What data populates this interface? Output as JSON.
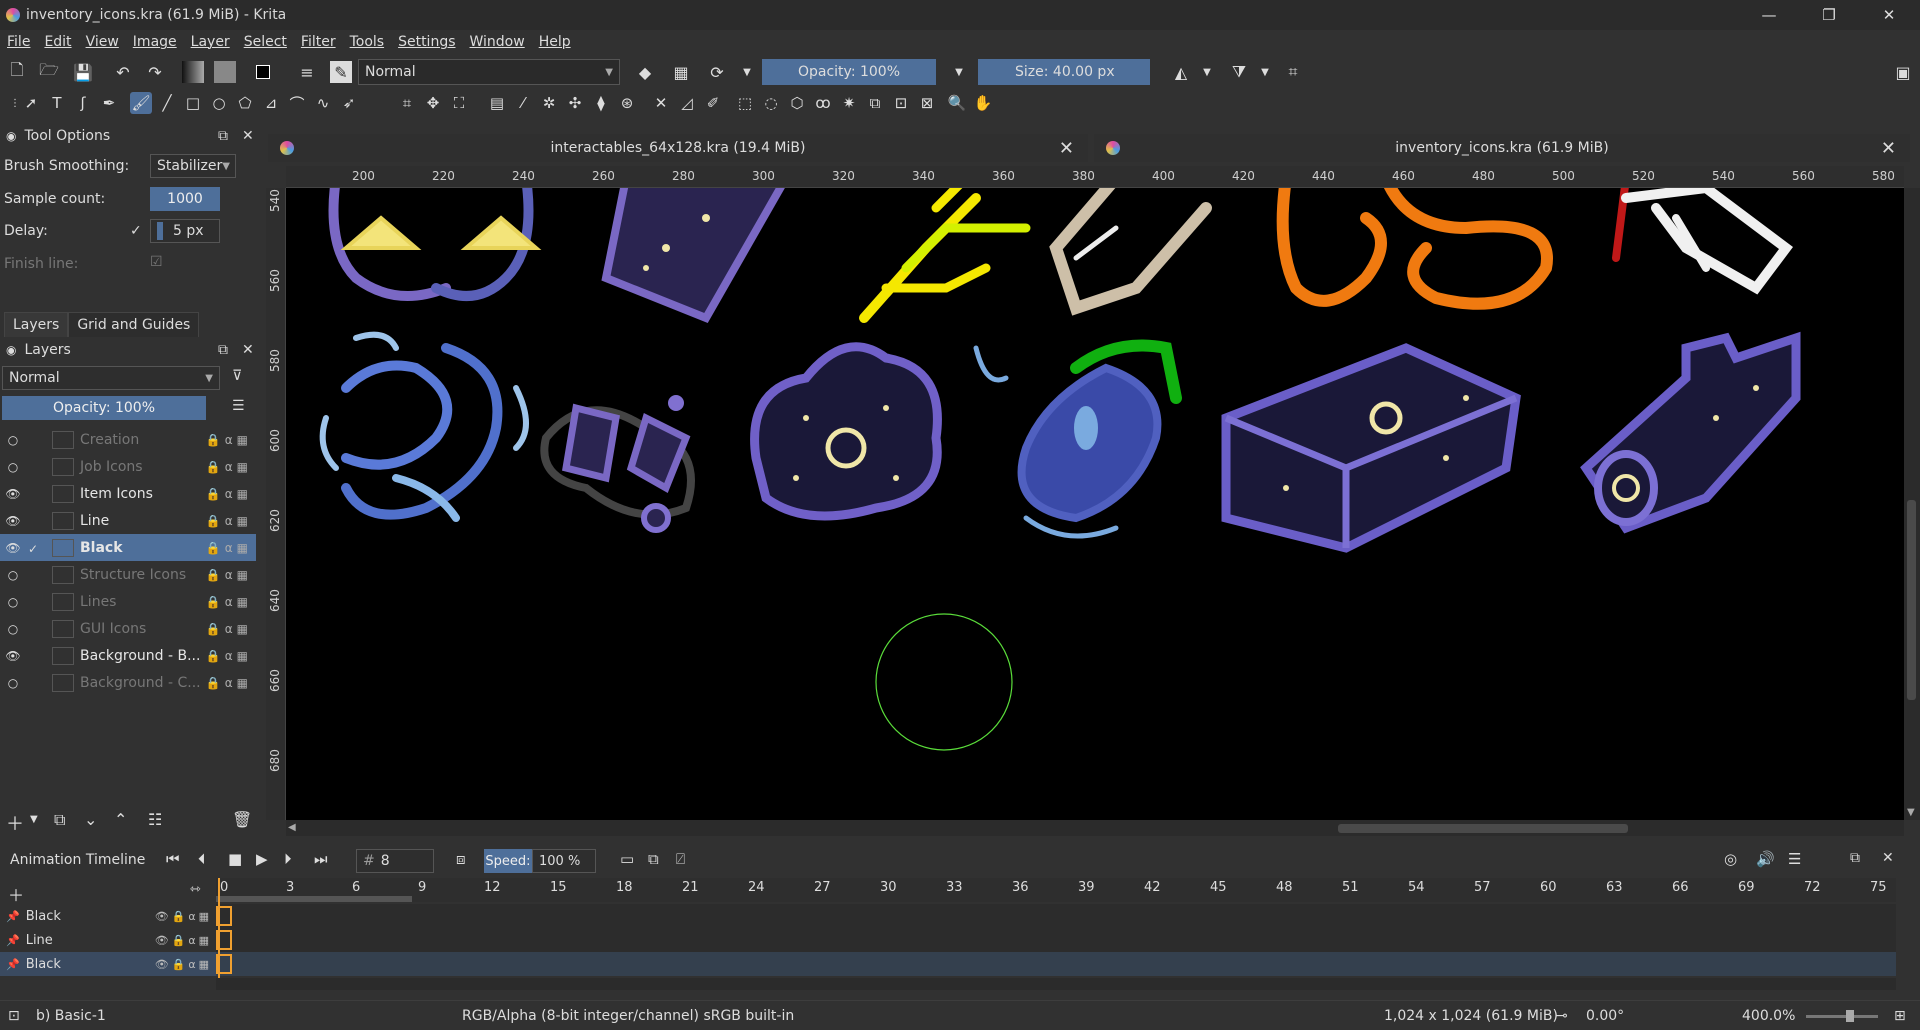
{
  "window": {
    "title": "inventory_icons.kra (61.9 MiB) - Krita",
    "minimize": "—",
    "maximize": "❐",
    "close": "✕"
  },
  "menu": [
    "File",
    "Edit",
    "View",
    "Image",
    "Layer",
    "Select",
    "Filter",
    "Tools",
    "Settings",
    "Window",
    "Help"
  ],
  "toolbar": {
    "blend_mode": "Normal",
    "opacity": "Opacity: 100%",
    "size": "Size: 40.00 px"
  },
  "tool_options": {
    "title": "Tool Options",
    "brush_smoothing_label": "Brush Smoothing:",
    "brush_smoothing_value": "Stabilizer",
    "sample_count_label": "Sample count:",
    "sample_count_value": "1000",
    "delay_label": "Delay:",
    "delay_value": "5 px",
    "finish_line_label": "Finish line:"
  },
  "layers_panel": {
    "tabs": [
      "Layers",
      "Grid and Guides"
    ],
    "title": "Layers",
    "blend_mode": "Normal",
    "opacity": "Opacity:  100%",
    "layers": [
      {
        "name": "Creation",
        "visible": false,
        "dim": true
      },
      {
        "name": "Job Icons",
        "visible": false,
        "dim": true
      },
      {
        "name": "Item Icons",
        "visible": true,
        "dim": false
      },
      {
        "name": "Line",
        "visible": true,
        "dim": false
      },
      {
        "name": "Black",
        "visible": true,
        "dim": false,
        "selected": true
      },
      {
        "name": "Structure Icons",
        "visible": false,
        "dim": true
      },
      {
        "name": "Lines",
        "visible": false,
        "dim": true
      },
      {
        "name": "GUI Icons",
        "visible": false,
        "dim": true
      },
      {
        "name": "Background - B...",
        "visible": true,
        "dim": false
      },
      {
        "name": "Background - C...",
        "visible": false,
        "dim": true
      }
    ]
  },
  "documents": [
    {
      "title": "interactables_64x128.kra (19.4 MiB)"
    },
    {
      "title": "inventory_icons.kra (61.9 MiB)"
    }
  ],
  "ruler": {
    "h_ticks": [
      "200",
      "220",
      "240",
      "260",
      "280",
      "300",
      "320",
      "340",
      "360",
      "380",
      "400",
      "420",
      "440",
      "460",
      "480",
      "500",
      "520",
      "540",
      "560",
      "580"
    ],
    "v_ticks": [
      "540",
      "560",
      "580",
      "600",
      "620",
      "640",
      "660",
      "680"
    ]
  },
  "timeline": {
    "title": "Animation Timeline",
    "frame": "8",
    "speed_label": "Speed:",
    "speed_value": "100 %",
    "frame_ticks": [
      "0",
      "3",
      "6",
      "9",
      "12",
      "15",
      "18",
      "21",
      "24",
      "27",
      "30",
      "33",
      "36",
      "39",
      "42",
      "45",
      "48",
      "51",
      "54",
      "57",
      "60",
      "63",
      "66",
      "69",
      "72",
      "75"
    ],
    "tracks": [
      "Black",
      "Line",
      "Black"
    ]
  },
  "status": {
    "brush": "b) Basic-1",
    "color_space": "RGB/Alpha (8-bit integer/channel)  sRGB built-in",
    "dimensions": "1,024 x 1,024 (61.9 MiB)",
    "rotation": "0.00°",
    "zoom": "400.0%"
  }
}
